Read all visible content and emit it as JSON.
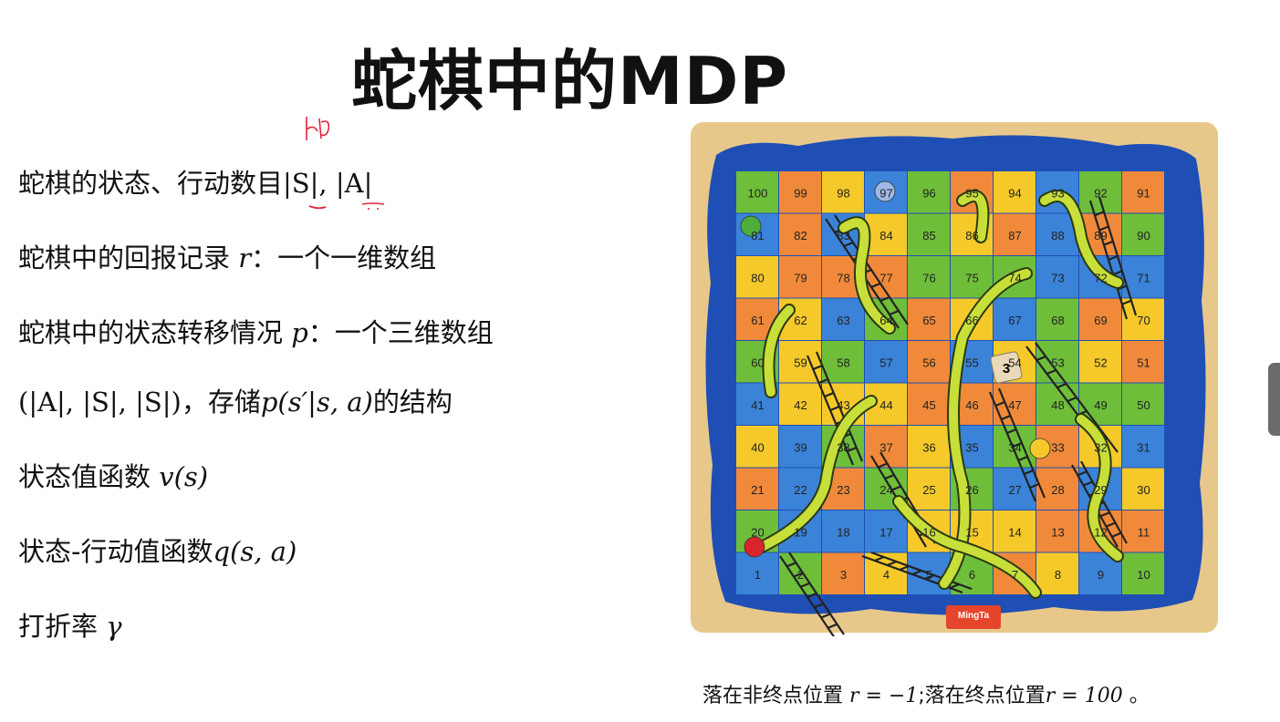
{
  "title": "蛇棋中的MDP",
  "handwriting": "|H|",
  "lines": [
    {
      "text": "蛇棋的状态、行动数目",
      "math": "|S|, |A|"
    },
    {
      "text": "蛇棋中的回报记录 ",
      "sym": "r",
      "rest": "：一个一维数组"
    },
    {
      "text": "蛇棋中的状态转移情况 ",
      "sym": "p",
      "rest": "：一个三维数组"
    },
    {
      "pre": "(|A|, |S|, |S|)",
      "text": "，存储",
      "sym": "p(s′|s, a)",
      "rest": "的结构"
    },
    {
      "text": "状态值函数 ",
      "sym": "v(s)"
    },
    {
      "text": "状态-行动值函数",
      "sym": "q(s, a)"
    },
    {
      "text": "打折率 ",
      "sym": "γ"
    }
  ],
  "note": {
    "a": "落在非终点位置 ",
    "r1": "r = −1",
    "b": ";落在终点位置",
    "r2": "r = 100",
    "c": " 。"
  },
  "board": {
    "numbers": [
      [
        100,
        99,
        98,
        97,
        96,
        95,
        94,
        93,
        92,
        91
      ],
      [
        81,
        82,
        83,
        84,
        85,
        86,
        87,
        88,
        89,
        90
      ],
      [
        80,
        79,
        78,
        77,
        76,
        75,
        74,
        73,
        72,
        71
      ],
      [
        61,
        62,
        63,
        64,
        65,
        66,
        67,
        68,
        69,
        70
      ],
      [
        60,
        59,
        58,
        57,
        56,
        55,
        54,
        53,
        52,
        51
      ],
      [
        41,
        42,
        43,
        44,
        45,
        46,
        47,
        48,
        49,
        50
      ],
      [
        40,
        39,
        38,
        37,
        36,
        35,
        34,
        33,
        32,
        31
      ],
      [
        21,
        22,
        23,
        24,
        25,
        26,
        27,
        28,
        29,
        30
      ],
      [
        20,
        19,
        18,
        17,
        16,
        15,
        14,
        13,
        12,
        11
      ],
      [
        1,
        2,
        3,
        4,
        5,
        6,
        7,
        8,
        9,
        10
      ]
    ],
    "brand": "MingTa",
    "die": "3",
    "colors": {
      "frame": "#e8c88a",
      "border": "#1f4fb5",
      "green": "#6fbe3a",
      "orange": "#f08a3a",
      "yellow": "#f5c92a",
      "blue": "#3b83d8",
      "snake": "#c8df3a"
    }
  }
}
